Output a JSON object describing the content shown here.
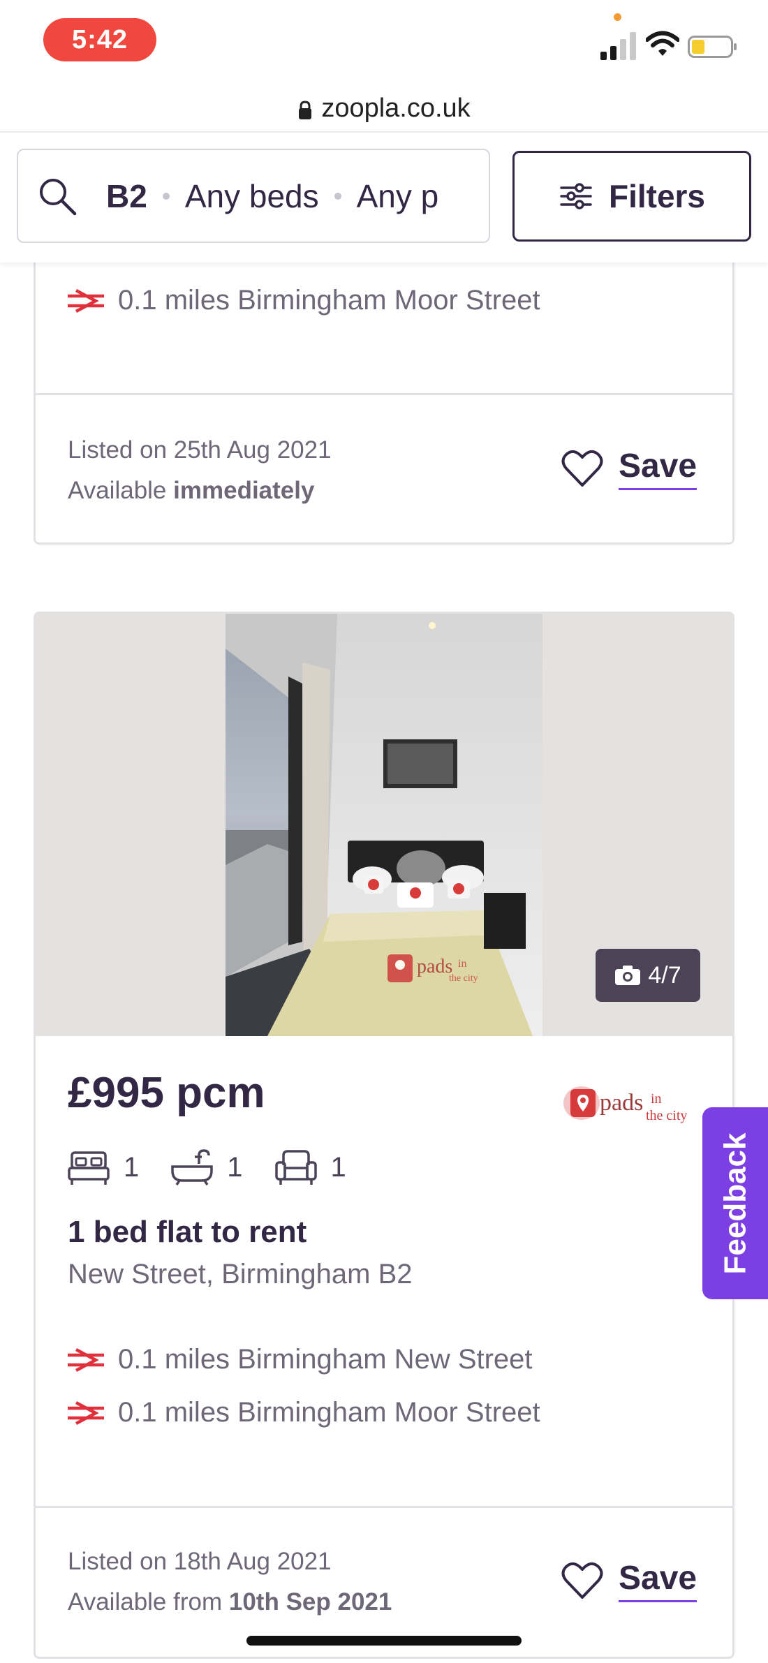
{
  "status_bar": {
    "time": "5:42"
  },
  "browser": {
    "url": "zoopla.co.uk"
  },
  "search": {
    "location": "B2",
    "beds": "Any beds",
    "price": "Any p",
    "filters_label": "Filters"
  },
  "listing_previous": {
    "station": "0.1 miles Birmingham Moor Street",
    "listed": "Listed on 25th Aug 2021",
    "available_prefix": "Available",
    "available_value": "immediately",
    "save_label": "Save"
  },
  "listing": {
    "photo_counter": "4/7",
    "price": "£995 pcm",
    "bedrooms": "1",
    "bathrooms": "1",
    "receptions": "1",
    "title": "1 bed flat to rent",
    "address": "New Street, Birmingham B2",
    "stations": [
      "0.1 miles Birmingham New Street",
      "0.1 miles Birmingham Moor Street"
    ],
    "listed": "Listed on 18th Aug 2021",
    "available_prefix": "Available from",
    "available_value": "10th Sep 2021",
    "save_label": "Save",
    "agent_logo": {
      "word1": "pads",
      "word2": "in",
      "word3": "the city"
    },
    "watermark": {
      "word1": "pads",
      "word2": "in",
      "word3": "the city"
    }
  },
  "feedback_label": "Feedback",
  "colors": {
    "brand_purple": "#7b3fe4",
    "text_dark": "#322744",
    "rail_red": "#e0303b",
    "time_pill": "#f0473f"
  }
}
